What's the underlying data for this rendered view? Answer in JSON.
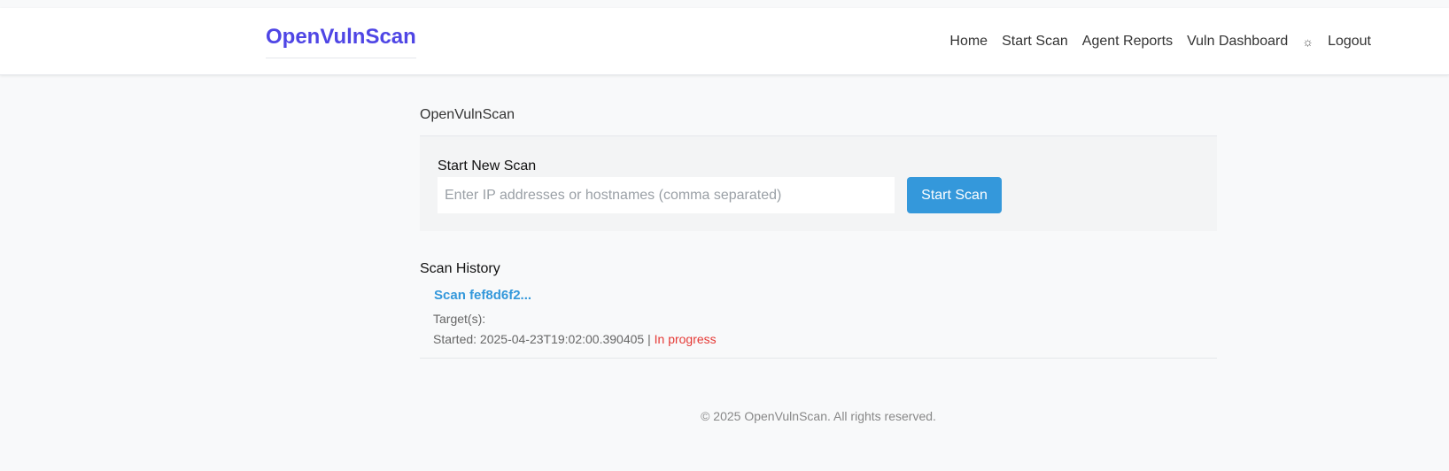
{
  "brand": "OpenVulnScan",
  "nav": {
    "home": "Home",
    "start_scan": "Start Scan",
    "agent_reports": "Agent Reports",
    "vuln_dashboard": "Vuln Dashboard",
    "theme_icon": "☼",
    "logout": "Logout"
  },
  "page": {
    "heading": "OpenVulnScan"
  },
  "new_scan": {
    "title": "Start New Scan",
    "placeholder": "Enter IP addresses or hostnames (comma separated)",
    "value": "",
    "button_label": "Start Scan"
  },
  "history": {
    "title": "Scan History",
    "items": [
      {
        "link": "Scan fef8d6f2...",
        "targets_label": "Target(s):",
        "targets": "",
        "started_label": "Started:",
        "started": "2025-04-23T19:02:00.390405",
        "separator": "|",
        "status": "In progress"
      }
    ]
  },
  "footer": "© 2025 OpenVulnScan. All rights reserved.",
  "colors": {
    "brand": "#4f46e5",
    "accent": "#3498db",
    "status_in_progress": "#e53935"
  }
}
